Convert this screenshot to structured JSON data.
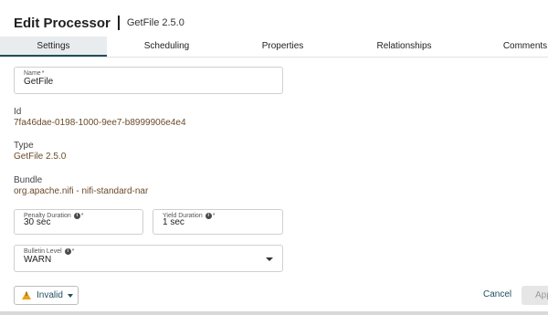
{
  "header": {
    "title": "Edit Processor",
    "subtitle": "GetFile 2.5.0"
  },
  "tabs": [
    {
      "label": "Settings",
      "active": true
    },
    {
      "label": "Scheduling",
      "active": false
    },
    {
      "label": "Properties",
      "active": false
    },
    {
      "label": "Relationships",
      "active": false
    },
    {
      "label": "Comments",
      "active": false
    }
  ],
  "name_field": {
    "label": "Name",
    "required_mark": "*",
    "value": "GetFile"
  },
  "id": {
    "label": "Id",
    "value": "7fa46dae-0198-1000-9ee7-b8999906e4e4"
  },
  "type": {
    "label": "Type",
    "value": "GetFile 2.5.0"
  },
  "bundle": {
    "label": "Bundle",
    "value": "org.apache.nifi - nifi-standard-nar"
  },
  "penalty_duration": {
    "label": "Penalty Duration",
    "required_mark": "*",
    "value": "30 sec"
  },
  "yield_duration": {
    "label": "Yield Duration",
    "required_mark": "*",
    "value": "1 sec"
  },
  "bulletin_level": {
    "label": "Bulletin Level",
    "required_mark": "*",
    "value": "WARN"
  },
  "footer": {
    "status_label": "Invalid",
    "cancel_label": "Cancel",
    "apply_label": "App"
  },
  "colors": {
    "accent": "#1f4e5f",
    "value_text": "#6b4a2a",
    "warning": "#e8a317"
  },
  "icons": {
    "info": "info-circle-icon",
    "warning": "warning-triangle-icon",
    "dropdown": "chevron-down-icon"
  }
}
